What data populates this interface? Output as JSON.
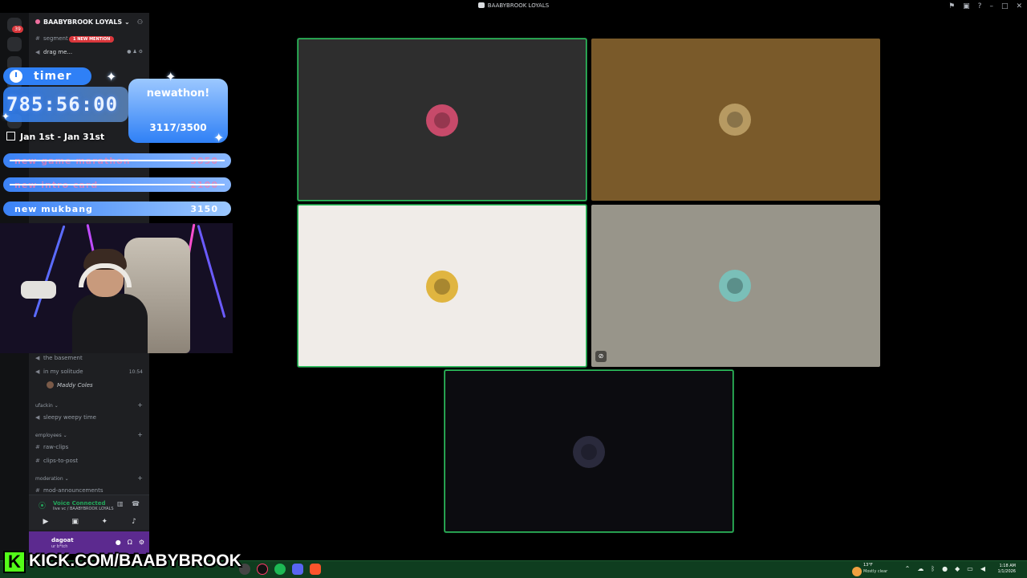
{
  "window": {
    "title": "BAABYBROOK LOYALS",
    "controls": [
      "inbox-icon",
      "screen-icon",
      "help-icon",
      "minimize-icon",
      "maximize-icon",
      "close-icon"
    ]
  },
  "server": {
    "name": "BAABYBROOK LOYALS",
    "mention_badge": "1 NEW MENTION"
  },
  "channels": [
    {
      "name": "segment",
      "icon": "hash"
    },
    {
      "name": "drag me...",
      "icon": "speaker"
    },
    {
      "name": "the basement",
      "icon": "speaker"
    },
    {
      "name": "in my solitude",
      "icon": "speaker",
      "time": "10:54"
    },
    {
      "name": "sleepy weepy time",
      "icon": "speaker"
    },
    {
      "name": "raw-clips",
      "icon": "hash"
    },
    {
      "name": "clips-to-post",
      "icon": "hash"
    }
  ],
  "member_in_voice": "Maddy Coles",
  "categories": [
    "ufackin",
    "employees",
    "moderation"
  ],
  "partial_channel": "mod-announcements",
  "voice_panel": {
    "status": "Voice Connected",
    "location": "live vc / BAABYBROOK LOYALS"
  },
  "user_panel": {
    "username": "dagoat",
    "status": "ur b*tch"
  },
  "overlay": {
    "timer_label": "timer",
    "timer_value": "785:56:00",
    "date_range": "Jan 1st - Jan 31st",
    "newathon_title": "newathon!",
    "newathon_progress": "3117/3500",
    "goals": [
      {
        "name": "new game marathon",
        "value": "3050",
        "done": true
      },
      {
        "name": "new intro card",
        "value": "2100",
        "done": true
      },
      {
        "name": "new mukbang",
        "value": "3150",
        "done": false
      }
    ],
    "kick_letter": "K",
    "kick_url": "KICK.COM/BAABYBROOK"
  },
  "video_tiles": [
    {
      "bg": "#2e2e2e",
      "speaking": true,
      "avatar": "#c74a6a"
    },
    {
      "bg": "#7a5a2a",
      "speaking": false,
      "avatar": "#b79a62"
    },
    {
      "bg": "#f0ece8",
      "speaking": true,
      "avatar": "#e0b540"
    },
    {
      "bg": "#98958a",
      "speaking": false,
      "avatar": "#7abfb8"
    },
    {
      "bg": "#0c0c10",
      "speaking": true,
      "avatar": "#2a2a3c"
    }
  ],
  "taskbar": {
    "weather_temp": "13°F",
    "weather_desc": "Mostly clear",
    "time": "1:18 AM",
    "date": "1/1/2026"
  },
  "colors": {
    "accent_green": "#2dc55e",
    "discord_bg": "#1e1f22",
    "overlay_blue": "#2f80f6",
    "kick_green": "#53fc18",
    "taskbar": "#0f3d1f"
  }
}
